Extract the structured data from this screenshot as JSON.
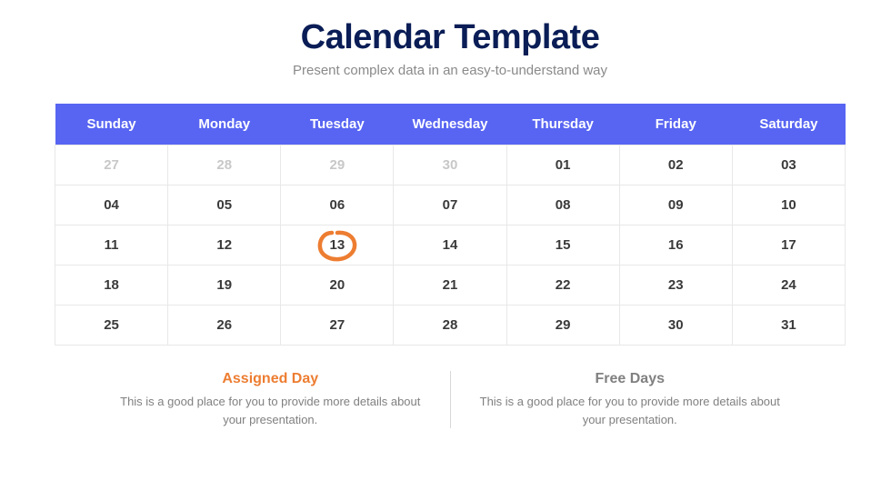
{
  "header": {
    "title": "Calendar Template",
    "subtitle": "Present complex data in an easy-to-understand way"
  },
  "calendar": {
    "days": [
      "Sunday",
      "Monday",
      "Tuesday",
      "Wednesday",
      "Thursday",
      "Friday",
      "Saturday"
    ],
    "rows": [
      [
        {
          "v": "27",
          "muted": true
        },
        {
          "v": "28",
          "muted": true
        },
        {
          "v": "29",
          "muted": true
        },
        {
          "v": "30",
          "muted": true
        },
        {
          "v": "01",
          "muted": false
        },
        {
          "v": "02",
          "muted": false
        },
        {
          "v": "03",
          "muted": false
        }
      ],
      [
        {
          "v": "04",
          "muted": false
        },
        {
          "v": "05",
          "muted": false
        },
        {
          "v": "06",
          "muted": false
        },
        {
          "v": "07",
          "muted": false
        },
        {
          "v": "08",
          "muted": false
        },
        {
          "v": "09",
          "muted": false
        },
        {
          "v": "10",
          "muted": false
        }
      ],
      [
        {
          "v": "11",
          "muted": false
        },
        {
          "v": "12",
          "muted": false
        },
        {
          "v": "13",
          "muted": false,
          "circled": true
        },
        {
          "v": "14",
          "muted": false
        },
        {
          "v": "15",
          "muted": false
        },
        {
          "v": "16",
          "muted": false
        },
        {
          "v": "17",
          "muted": false
        }
      ],
      [
        {
          "v": "18",
          "muted": false
        },
        {
          "v": "19",
          "muted": false
        },
        {
          "v": "20",
          "muted": false
        },
        {
          "v": "21",
          "muted": false
        },
        {
          "v": "22",
          "muted": false
        },
        {
          "v": "23",
          "muted": false
        },
        {
          "v": "24",
          "muted": false
        }
      ],
      [
        {
          "v": "25",
          "muted": false
        },
        {
          "v": "26",
          "muted": false
        },
        {
          "v": "27",
          "muted": false
        },
        {
          "v": "28",
          "muted": false
        },
        {
          "v": "29",
          "muted": false
        },
        {
          "v": "30",
          "muted": false
        },
        {
          "v": "31",
          "muted": false
        }
      ]
    ]
  },
  "footer": {
    "assigned": {
      "title": "Assigned Day",
      "text": "This is a good place for you to provide more details about your presentation."
    },
    "free": {
      "title": "Free Days",
      "text": "This is a good place for you to provide more details about your presentation."
    }
  },
  "colors": {
    "accent_orange": "#ed7d31",
    "header_blue": "#5865f2",
    "title_navy": "#0a1d56"
  }
}
